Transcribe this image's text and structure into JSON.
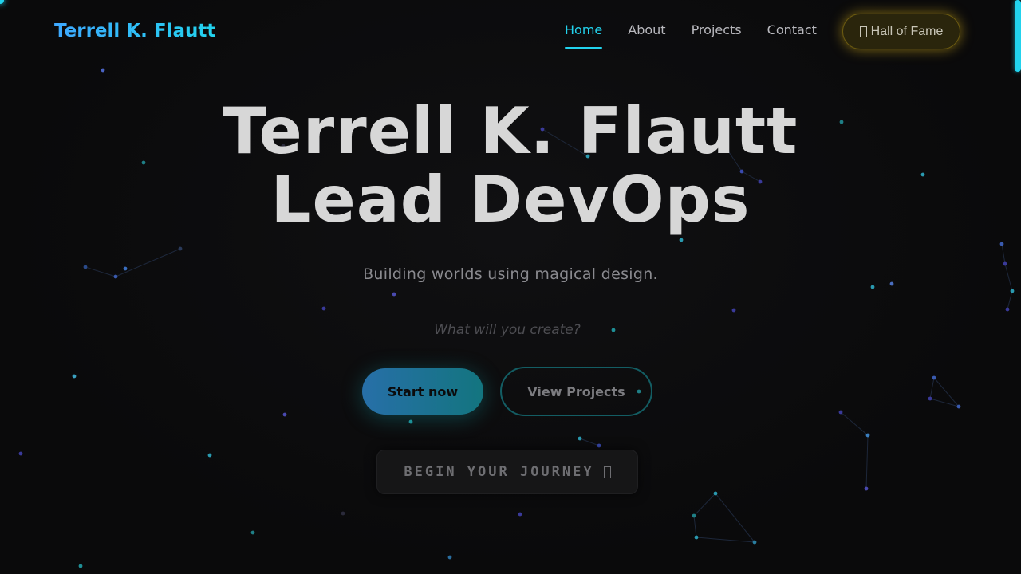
{
  "brand": {
    "name": "Terrell K. Flautt"
  },
  "nav": {
    "items": [
      {
        "label": "Home",
        "active": true
      },
      {
        "label": "About",
        "active": false
      },
      {
        "label": "Projects",
        "active": false
      },
      {
        "label": "Contact",
        "active": false
      }
    ],
    "hall_of_fame": {
      "label": "Hall of Fame",
      "icon": "trophy-icon"
    }
  },
  "hero": {
    "title_line1": "Terrell K. Flautt",
    "title_line2": "Lead DevOps",
    "tagline": "Building worlds using magical design.",
    "prompt": "What will you create?"
  },
  "actions": {
    "start_label": "Start now",
    "projects_label": "View Projects",
    "journey_label": "BEGIN YOUR JOURNEY",
    "journey_icon": "sparkle-icon"
  },
  "colors": {
    "background": "#0a0a0b",
    "accent": "#22d3ee",
    "brand_blue": "#3ea8ff",
    "gold_glow": "#eac01e",
    "title_text": "#d7d7d7"
  }
}
